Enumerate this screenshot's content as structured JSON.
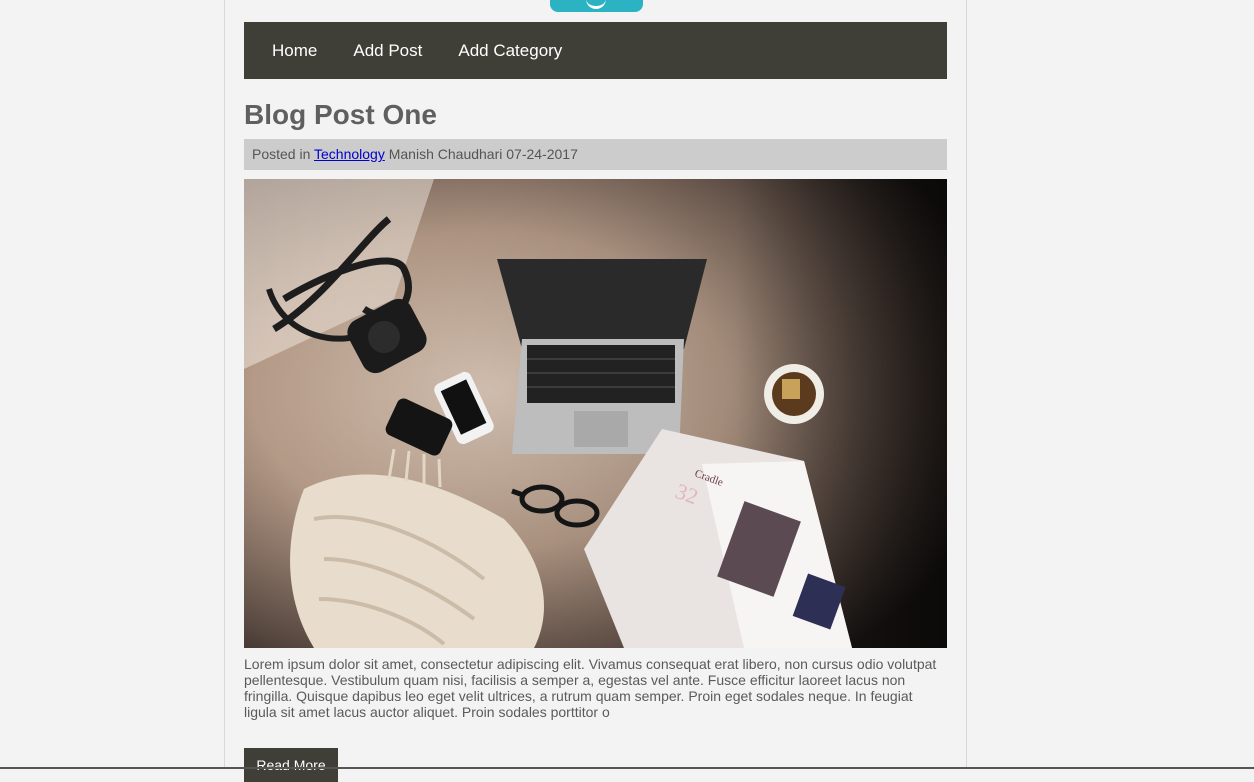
{
  "nav": {
    "items": [
      {
        "label": "Home"
      },
      {
        "label": "Add Post"
      },
      {
        "label": "Add Category"
      }
    ]
  },
  "post": {
    "title": "Blog Post One",
    "meta_prefix": "Posted in",
    "category": "Technology",
    "author": "Manish Chaudhari",
    "date": "07-24-2017",
    "image_alt": "desk-flatlay-photo",
    "excerpt": "Lorem ipsum dolor sit amet, consectetur adipiscing elit. Vivamus consequat erat libero, non cursus odio volutpat pellentesque. Vestibulum quam nisi, facilisis a semper a, egestas vel ante. Fusce efficitur laoreet lacus non fringilla. Quisque dapibus leo eget velit ultrices, a rutrum quam semper. Proin eget sodales neque. In feugiat ligula sit amet lacus auctor aliquet. Proin sodales porttitor o",
    "read_more": "Read More"
  },
  "colors": {
    "nav_bg": "#3f3f37",
    "accent_logo": "#2bb3c4",
    "meta_bg": "#cccccc",
    "link": "#0000cc"
  }
}
